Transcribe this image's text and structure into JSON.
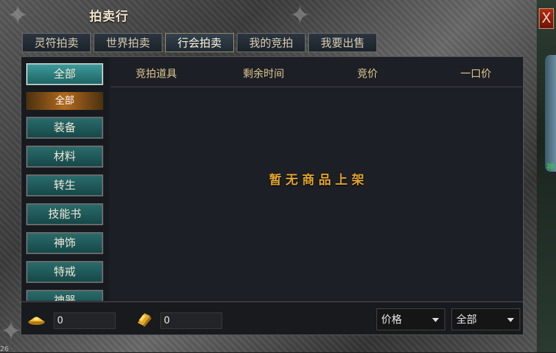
{
  "window": {
    "title": "拍卖行",
    "close_label": "X"
  },
  "tabs": [
    {
      "label": "灵符拍卖",
      "active": false
    },
    {
      "label": "世界拍卖",
      "active": false
    },
    {
      "label": "行会拍卖",
      "active": true
    },
    {
      "label": "我的竞拍",
      "active": false
    },
    {
      "label": "我要出售",
      "active": false
    }
  ],
  "sidebar": {
    "selected_category": "全部",
    "sub_selected": "全部",
    "items": [
      "装备",
      "材料",
      "转生",
      "技能书",
      "神饰",
      "特戒",
      "神器"
    ]
  },
  "table": {
    "columns": [
      "竞拍道具",
      "剩余时间",
      "竞价",
      "一口价"
    ],
    "empty_message": "暂无商品上架"
  },
  "currency": {
    "ingot_value": "0",
    "gold_value": "0"
  },
  "filters": {
    "sort_value": "价格",
    "category_value": "全部"
  },
  "npc_name": "神",
  "corner_text": "26",
  "colors": {
    "accent": "#e2a32d",
    "teal": "#1d6464",
    "tab_active": "#34424f"
  }
}
